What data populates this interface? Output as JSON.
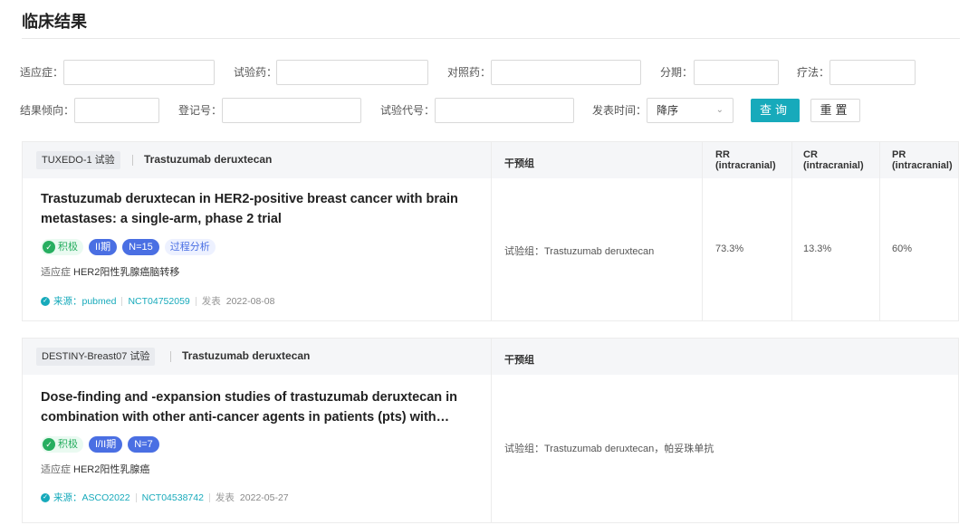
{
  "page": {
    "title": "临床结果"
  },
  "filters": {
    "indication": "适应症：",
    "test_drug": "试验药：",
    "control_drug": "对照药：",
    "stage": "分期：",
    "therapy": "疗法：",
    "result_tendency": "结果倾向：",
    "registry_no": "登记号：",
    "trial_code": "试验代号：",
    "pub_time": "发表时间：",
    "sort_value": "降序",
    "query_button": "查询",
    "reset_button": "重置"
  },
  "table_headers": {
    "intervention": "干预组",
    "rr": "RR (intracranial)",
    "cr": "CR (intracranial)",
    "pr": "PR (intracranial)"
  },
  "results": [
    {
      "trial_tag": "TUXEDO-1 试验",
      "drug": "Trastuzumab deruxtecan",
      "title": "Trastuzumab deruxtecan in HER2-positive breast cancer with brain metastases: a single-arm, phase 2 trial",
      "badges": {
        "positive": "积极",
        "phase": "II期",
        "n": "N=15",
        "extra": "过程分析"
      },
      "indication_label": "适应症",
      "indication_value": "HER2阳性乳腺癌脑转移",
      "source": "来源：pubmed",
      "registry": "NCT04752059",
      "published_label": "发表",
      "published_date": "2022-08-08",
      "arm": "试验组：Trastuzumab deruxtecan",
      "rr": "73.3%",
      "cr": "13.3%",
      "pr": "60%"
    },
    {
      "trial_tag": "DESTINY-Breast07 试验",
      "drug": "Trastuzumab deruxtecan",
      "title": "Dose-finding and -expansion studies of trastuzumab deruxtecan in combination with other anti-cancer agents in patients (pts) with…",
      "badges": {
        "positive": "积极",
        "phase": "I/II期",
        "n": "N=7"
      },
      "indication_label": "适应症",
      "indication_value": "HER2阳性乳腺癌",
      "source": "来源：ASCO2022",
      "registry": "NCT04538742",
      "published_label": "发表",
      "published_date": "2022-05-27",
      "arm": "试验组：Trastuzumab deruxtecan，帕妥珠单抗"
    }
  ],
  "icons": {
    "positive": "check-shield-icon",
    "source": "check-circle-icon",
    "dropdown": "chevron-down-icon"
  },
  "colors": {
    "accent": "#17aabb",
    "phase_badge": "#4a6fe3",
    "positive": "#27ae60"
  }
}
